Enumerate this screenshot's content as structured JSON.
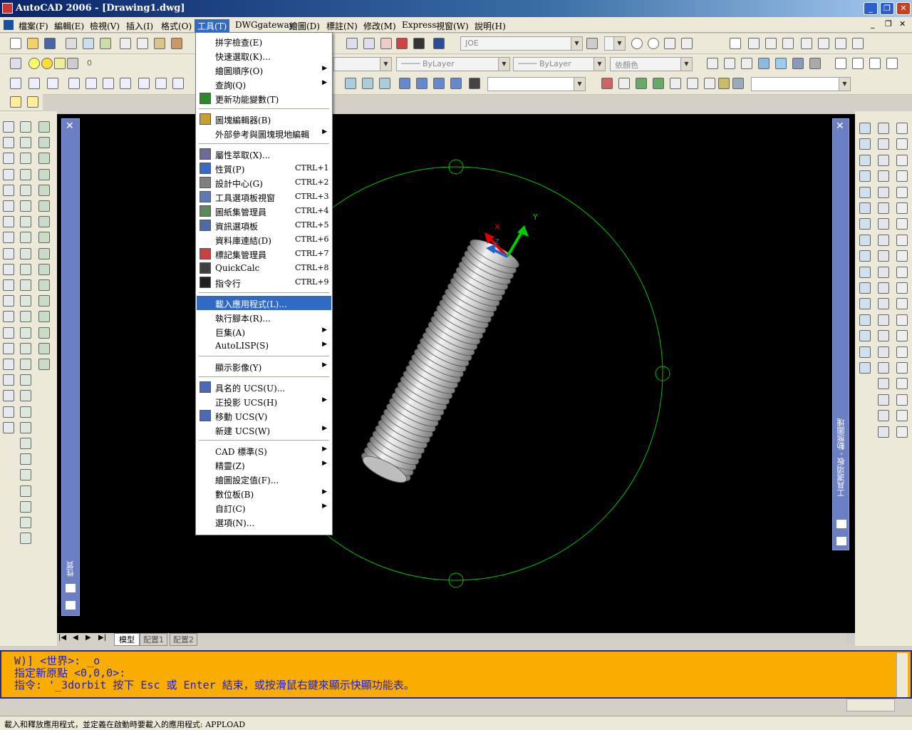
{
  "window": {
    "title": "AutoCAD 2006 - [Drawing1.dwg]"
  },
  "menubar": {
    "items": [
      "檔案(F)",
      "編輯(E)",
      "檢視(V)",
      "插入(I)",
      "格式(O)",
      "工具(T)",
      "DWGgateway",
      "繪圖(D)",
      "標註(N)",
      "修改(M)",
      "Express",
      "視窗(W)",
      "說明(H)"
    ]
  },
  "toolbar": {
    "layer_value": "0",
    "layer_combo": "JOE",
    "linetype_combo": "ByLayer",
    "lineweight_combo": "ByLayer",
    "color_combo": "依顏色"
  },
  "tools_menu": {
    "items": [
      {
        "label": "拼字檢查(E)",
        "shortcut": "",
        "sub": false,
        "icon": ""
      },
      {
        "label": "快速選取(K)...",
        "shortcut": "",
        "sub": false,
        "icon": ""
      },
      {
        "label": "繪圖順序(O)",
        "shortcut": "",
        "sub": true,
        "icon": ""
      },
      {
        "label": "查詢(Q)",
        "shortcut": "",
        "sub": true,
        "icon": ""
      },
      {
        "label": "更新功能變數(T)",
        "shortcut": "",
        "sub": false,
        "icon": "update-fields-icon"
      },
      {
        "sep": true
      },
      {
        "label": "圖塊編輯器(B)",
        "shortcut": "",
        "sub": false,
        "icon": "block-editor-icon"
      },
      {
        "label": "外部參考與圖塊現地編輯",
        "shortcut": "",
        "sub": true,
        "icon": ""
      },
      {
        "sep": true
      },
      {
        "label": "屬性萃取(X)...",
        "shortcut": "",
        "sub": false,
        "icon": "attribute-extract-icon"
      },
      {
        "label": "性質(P)",
        "shortcut": "CTRL+1",
        "sub": false,
        "icon": "properties-icon"
      },
      {
        "label": "設計中心(G)",
        "shortcut": "CTRL+2",
        "sub": false,
        "icon": "design-center-icon"
      },
      {
        "label": "工具選項板視窗",
        "shortcut": "CTRL+3",
        "sub": false,
        "icon": "tool-palettes-icon"
      },
      {
        "label": "圖紙集管理員",
        "shortcut": "CTRL+4",
        "sub": false,
        "icon": "sheet-set-icon"
      },
      {
        "label": "資訊選項板",
        "shortcut": "CTRL+5",
        "sub": false,
        "icon": "info-palette-icon"
      },
      {
        "label": "資料庫連結(D)",
        "shortcut": "CTRL+6",
        "sub": false,
        "icon": ""
      },
      {
        "label": "標記集管理員",
        "shortcut": "CTRL+7",
        "sub": false,
        "icon": "markup-set-icon"
      },
      {
        "label": "QuickCalc",
        "shortcut": "CTRL+8",
        "sub": false,
        "icon": "calculator-icon"
      },
      {
        "label": "指令行",
        "shortcut": "CTRL+9",
        "sub": false,
        "icon": "command-line-icon"
      },
      {
        "sep": true
      },
      {
        "label": "載入應用程式(L)...",
        "shortcut": "",
        "sub": false,
        "icon": "",
        "highlight": true
      },
      {
        "label": "執行腳本(R)...",
        "shortcut": "",
        "sub": false,
        "icon": ""
      },
      {
        "label": "巨集(A)",
        "shortcut": "",
        "sub": true,
        "icon": ""
      },
      {
        "label": "AutoLISP(S)",
        "shortcut": "",
        "sub": true,
        "icon": ""
      },
      {
        "sep": true
      },
      {
        "label": "顯示影像(Y)",
        "shortcut": "",
        "sub": true,
        "icon": ""
      },
      {
        "sep": true
      },
      {
        "label": "具名的 UCS(U)...",
        "shortcut": "",
        "sub": false,
        "icon": "named-ucs-icon"
      },
      {
        "label": "正投影 UCS(H)",
        "shortcut": "",
        "sub": true,
        "icon": ""
      },
      {
        "label": "移動 UCS(V)",
        "shortcut": "",
        "sub": false,
        "icon": "move-ucs-icon"
      },
      {
        "label": "新建 UCS(W)",
        "shortcut": "",
        "sub": true,
        "icon": ""
      },
      {
        "sep": true
      },
      {
        "label": "CAD 標準(S)",
        "shortcut": "",
        "sub": true,
        "icon": ""
      },
      {
        "label": "精靈(Z)",
        "shortcut": "",
        "sub": true,
        "icon": ""
      },
      {
        "label": "繪圖設定值(F)...",
        "shortcut": "",
        "sub": false,
        "icon": ""
      },
      {
        "label": "數位板(B)",
        "shortcut": "",
        "sub": true,
        "icon": ""
      },
      {
        "label": "自訂(C)",
        "shortcut": "",
        "sub": true,
        "icon": ""
      },
      {
        "label": "選項(N)...",
        "shortcut": "",
        "sub": false,
        "icon": ""
      }
    ]
  },
  "palettes": {
    "left_title": "性質",
    "right_title": "工具選項板 - 動態圖塊"
  },
  "layout_tabs": [
    "模型",
    "配置1",
    "配置2"
  ],
  "command": {
    "lines": [
      "W)] <世界>: _o",
      "指定新原點 <0,0,0>:",
      "指令: '_3dorbit 按下 Esc 或 Enter 結束，或按滑鼠右鍵來顯示快顯功能表。"
    ]
  },
  "status": {
    "text": "載入和釋放應用程式，並定義在啟動時要載入的應用程式: APPLOAD"
  },
  "ucs": {
    "x": "X",
    "y": "Y",
    "z": "Z"
  },
  "colors": {
    "orbit_circle": "#00c000",
    "menu_highlight": "#316ac5",
    "command_bg": "#f9ad00",
    "command_text": "#1b1bd6"
  }
}
